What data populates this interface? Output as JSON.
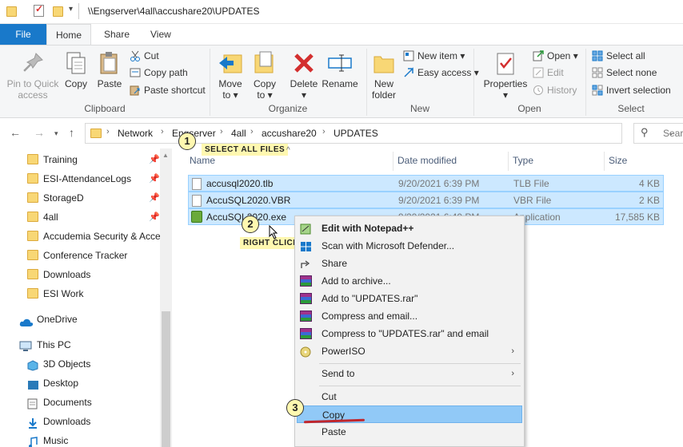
{
  "window": {
    "title_path": "\\\\Engserver\\4all\\accushare20\\UPDATES"
  },
  "tabs": [
    {
      "label": "File"
    },
    {
      "label": "Home"
    },
    {
      "label": "Share"
    },
    {
      "label": "View"
    }
  ],
  "ribbon": {
    "clipboard": {
      "label": "Clipboard",
      "pin": "Pin to Quick access",
      "pin_l1": "Pin to Quick",
      "pin_l2": "access",
      "copy": "Copy",
      "paste": "Paste",
      "cut": "Cut",
      "copy_path": "Copy path",
      "paste_shortcut": "Paste shortcut"
    },
    "organize": {
      "label": "Organize",
      "move_l1": "Move",
      "move_l2": "to",
      "copy_l1": "Copy",
      "copy_l2": "to",
      "delete": "Delete",
      "rename": "Rename"
    },
    "new": {
      "label": "New",
      "new_folder_l1": "New",
      "new_folder_l2": "folder",
      "new_item": "New item",
      "easy_access": "Easy access"
    },
    "open": {
      "label": "Open",
      "properties": "Properties",
      "open": "Open",
      "edit": "Edit",
      "history": "History"
    },
    "select": {
      "label": "Select",
      "select_all": "Select all",
      "select_none": "Select none",
      "invert": "Invert selection"
    }
  },
  "address": {
    "crumbs": [
      "Network",
      "Engserver",
      "4all",
      "accushare20",
      "UPDATES"
    ],
    "search_placeholder": "Search"
  },
  "sidebar": {
    "items": [
      {
        "label": "Training",
        "pinned": true
      },
      {
        "label": "ESI-AttendanceLogs",
        "pinned": true
      },
      {
        "label": "StorageD",
        "pinned": true
      },
      {
        "label": "4all",
        "pinned": true
      },
      {
        "label": "Accudemia Security & Access"
      },
      {
        "label": "Conference Tracker"
      },
      {
        "label": "Downloads"
      },
      {
        "label": "ESI Work"
      },
      {
        "label": "OneDrive"
      },
      {
        "label": "This PC"
      },
      {
        "label": "3D Objects"
      },
      {
        "label": "Desktop"
      },
      {
        "label": "Documents"
      },
      {
        "label": "Downloads"
      },
      {
        "label": "Music"
      }
    ]
  },
  "columns": {
    "name": "Name",
    "date": "Date modified",
    "type": "Type",
    "size": "Size"
  },
  "files": [
    {
      "name": "accusql2020.tlb",
      "date": "9/20/2021 6:39 PM",
      "type": "TLB File",
      "size": "4 KB"
    },
    {
      "name": "AccuSQL2020.VBR",
      "date": "9/20/2021 6:39 PM",
      "type": "VBR File",
      "size": "2 KB"
    },
    {
      "name": "AccuSQL2020.exe",
      "date": "9/20/2021 6:40 PM",
      "type": "Application",
      "size": "17,585 KB"
    }
  ],
  "callouts": {
    "step1": {
      "num": "1",
      "text": "SELECT ALL FILES"
    },
    "step2": {
      "num": "2",
      "text": "RIGHT CLICK"
    },
    "step3": {
      "num": "3"
    }
  },
  "context_menu": {
    "items": [
      {
        "label": "Edit with Notepad++"
      },
      {
        "label": "Scan with Microsoft Defender..."
      },
      {
        "label": "Share"
      },
      {
        "label": "Add to archive..."
      },
      {
        "label": "Add to \"UPDATES.rar\""
      },
      {
        "label": "Compress and email..."
      },
      {
        "label": "Compress to \"UPDATES.rar\" and email"
      },
      {
        "label": "PowerISO"
      },
      {
        "label": "Send to"
      },
      {
        "label": "Cut"
      },
      {
        "label": "Copy"
      },
      {
        "label": "Paste"
      }
    ]
  },
  "colors": {
    "accent": "#1979ca",
    "selection": "#cce8ff",
    "highlight": "#91c9f7",
    "callout": "#fff8b0",
    "underline": "#c0262d"
  }
}
